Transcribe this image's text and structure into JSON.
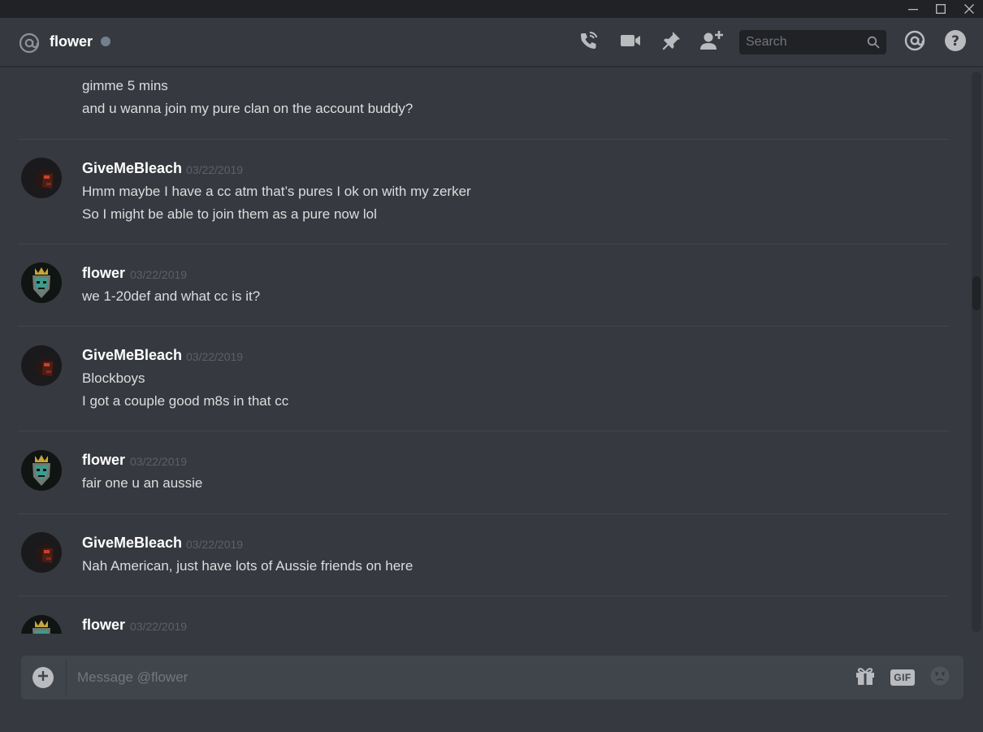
{
  "window": {
    "minimize_icon": "minimize-icon",
    "maximize_icon": "maximize-icon",
    "close_icon": "close-icon"
  },
  "header": {
    "channel_icon": "at-icon",
    "channel_name": "flower",
    "status": "offline",
    "icons": [
      "call-icon",
      "video-icon",
      "pin-icon",
      "add-friend-icon",
      "mentions-icon",
      "help-icon"
    ],
    "search_placeholder": "Search"
  },
  "messages": {
    "cont": [
      {
        "text": "gimme 5 mins"
      },
      {
        "text": "and u wanna join my pure clan on the account buddy?"
      }
    ],
    "groups": [
      {
        "author": "GiveMeBleach",
        "timestamp": "03/22/2019",
        "lines": [
          "Hmm maybe I have a cc atm that’s pures I ok on with my zerker",
          "So I might be able to join them as a pure now lol"
        ]
      },
      {
        "author": "flower",
        "timestamp": "03/22/2019",
        "lines": [
          "we 1-20def and what cc is it?"
        ]
      },
      {
        "author": "GiveMeBleach",
        "timestamp": "03/22/2019",
        "lines": [
          "Blockboys",
          "I got a couple good m8s in that cc"
        ]
      },
      {
        "author": "flower",
        "timestamp": "03/22/2019",
        "lines": [
          "fair one u an aussie"
        ]
      },
      {
        "author": "GiveMeBleach",
        "timestamp": "03/22/2019",
        "lines": [
          "Nah American, just have lots of Aussie friends on here"
        ]
      },
      {
        "author": "flower",
        "timestamp": "03/22/2019",
        "lines": []
      }
    ]
  },
  "composer": {
    "placeholder": "Message @flower",
    "upload_icon": "plus-circle-icon",
    "gift_icon": "gift-icon",
    "gif_label": "GIF",
    "emoji_icon": "emoji-icon"
  },
  "colors": {
    "background": "#36393f",
    "titlebar": "#202225",
    "input": "#40444b",
    "text": "#dcddde",
    "muted": "#72767d"
  }
}
